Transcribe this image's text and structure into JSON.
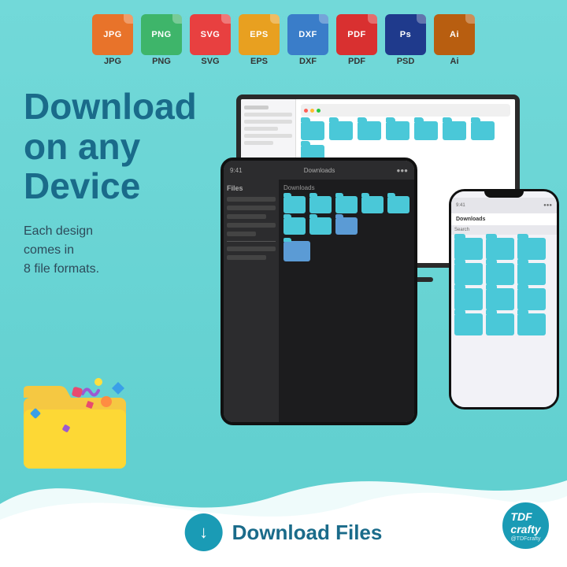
{
  "background_color": "#6fd4d4",
  "file_formats": [
    {
      "ext": "JPG",
      "label": "JPG",
      "color": "#e8732a"
    },
    {
      "ext": "PNG",
      "label": "PNG",
      "color": "#3eb56a"
    },
    {
      "ext": "SVG",
      "label": "SVG",
      "color": "#e84040"
    },
    {
      "ext": "EPS",
      "label": "EPS",
      "color": "#e8a020"
    },
    {
      "ext": "DXF",
      "label": "DXF",
      "color": "#3a7dc9"
    },
    {
      "ext": "PDF",
      "label": "PDF",
      "color": "#d93030"
    },
    {
      "ext": "PSD",
      "label": "Ps",
      "color": "#1f3a8c"
    },
    {
      "ext": "AI",
      "label": "Ai",
      "color": "#b85e10"
    }
  ],
  "headline": {
    "line1": "Download",
    "line2": "on any",
    "line3": "Device"
  },
  "subtext": "Each design\ncomes in\n8 file formats.",
  "download_button": {
    "label": "Download Files",
    "icon": "↓"
  },
  "brand": {
    "name": "TDFcrafty",
    "handle": "@TDFcrafty"
  }
}
